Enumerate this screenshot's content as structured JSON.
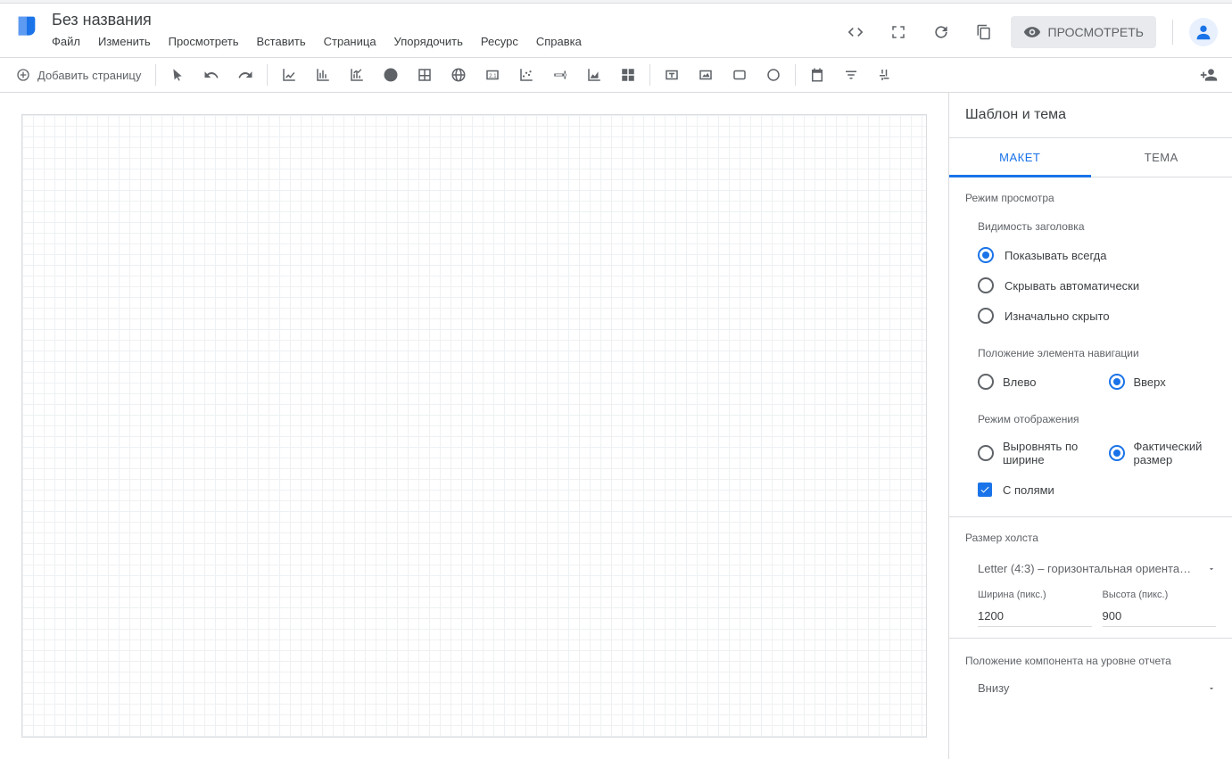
{
  "header": {
    "doc_title": "Без названия",
    "menu": [
      "Файл",
      "Изменить",
      "Просмотреть",
      "Вставить",
      "Страница",
      "Упорядочить",
      "Ресурс",
      "Справка"
    ],
    "preview_label": "ПРОСМОТРЕТЬ"
  },
  "toolbar": {
    "add_page": "Добавить страницу"
  },
  "panel": {
    "title": "Шаблон и тема",
    "tabs": {
      "layout": "МАКЕТ",
      "theme": "ТЕМА"
    },
    "view_mode": {
      "title": "Режим просмотра",
      "header_visibility": {
        "title": "Видимость заголовка",
        "options": [
          "Показывать всегда",
          "Скрывать автоматически",
          "Изначально скрыто"
        ]
      },
      "nav_position": {
        "title": "Положение элемента навигации",
        "left": "Влево",
        "top": "Вверх"
      },
      "display_mode": {
        "title": "Режим отображения",
        "fit": "Выровнять по ширине",
        "actual": "Фактический размер",
        "margins": "С полями"
      }
    },
    "canvas_size": {
      "title": "Размер холста",
      "preset": "Letter (4:3) – горизонтальная ориента…",
      "width_label": "Ширина (пикс.)",
      "width_value": "1200",
      "height_label": "Высота (пикс.)",
      "height_value": "900"
    },
    "component_position": {
      "title": "Положение компонента на уровне отчета",
      "value": "Внизу"
    }
  }
}
